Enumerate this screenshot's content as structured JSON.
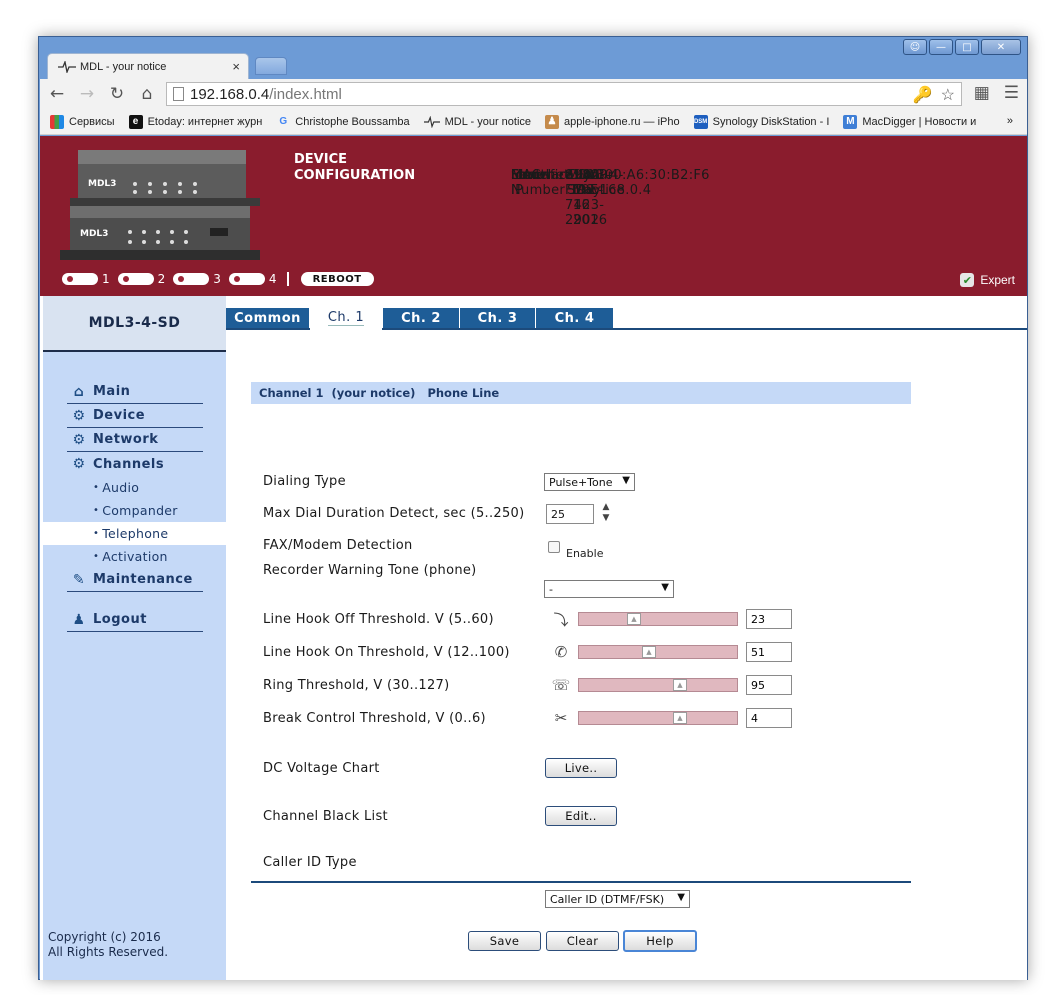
{
  "browser": {
    "tab_title": "MDL - your notice",
    "tab_close": "×",
    "url_host": "192.168.0.4",
    "url_path": "/index.html",
    "bookmarks": [
      {
        "icon": "apps-icon",
        "label": "Сервисы"
      },
      {
        "icon": "e-icon",
        "label": "Etoday: интернет журн"
      },
      {
        "icon": "google-icon",
        "label": "Christophe Boussamba"
      },
      {
        "icon": "pulse-icon",
        "label": "MDL - your notice"
      },
      {
        "icon": "person-icon",
        "label": "apple-iphone.ru — iPho"
      },
      {
        "icon": "dsm-icon",
        "label": "Synology DiskStation - I"
      },
      {
        "icon": "m-icon",
        "label": "MacDigger | Новости и"
      }
    ],
    "bookmarks_more": "»"
  },
  "header": {
    "title_line1": "DEVICE",
    "title_line2": "CONFIGURATION",
    "info": [
      {
        "key": "Model",
        "value": "MDL3-4-SD"
      },
      {
        "key": "Serial Number",
        "value": "898A-F59E-7423-2902"
      },
      {
        "key": "Firmware",
        "value": "1.00 - May 16 2016"
      },
      {
        "key": "MAC",
        "value": "02:00:A6:30:B2:F6"
      },
      {
        "key": "Ethernet IP",
        "value": "DHCP: 192.168.0.4"
      },
      {
        "key": "Identification",
        "value": "your notice"
      }
    ],
    "leds": [
      "1",
      "2",
      "3",
      "4"
    ],
    "reboot": "REBOOT",
    "expert": "Expert",
    "device_label_top": "MDL3",
    "device_label_bottom": "MDL3"
  },
  "sidebar": {
    "title": "MDL3-4-SD",
    "main": "Main",
    "device": "Device",
    "network": "Network",
    "channels": "Channels",
    "sub": [
      "Audio",
      "Compander",
      "Telephone",
      "Activation"
    ],
    "maintenance": "Maintenance",
    "logout": "Logout",
    "copyright1": "Copyright (c) 2016",
    "copyright2": "All Rights Reserved."
  },
  "tabs": [
    "Common",
    "Ch. 1",
    "Ch. 2",
    "Ch. 3",
    "Ch. 4"
  ],
  "channel": {
    "header_ch": "Channel 1",
    "header_name": "(your notice)",
    "header_type": "Phone Line"
  },
  "form": {
    "dialing_type_label": "Dialing Type",
    "dialing_type_value": "Pulse+Tone",
    "max_dial_label": "Max Dial Duration Detect, sec (5..250)",
    "max_dial_value": "25",
    "fax_label": "FAX/Modem Detection",
    "fax_enable": "Enable",
    "fax_checked": false,
    "recorder_label": "Recorder Warning Tone (phone)",
    "recorder_value": "-",
    "sliders": [
      {
        "label": "Line Hook Off Threshold. V (5..60)",
        "icon": "hook-off-icon",
        "value": "23",
        "fraction": 0.33
      },
      {
        "label": "Line Hook On Threshold, V (12..100)",
        "icon": "phone-icon",
        "value": "51",
        "fraction": 0.44
      },
      {
        "label": "Ring Threshold, V (30..127)",
        "icon": "ring-icon",
        "value": "95",
        "fraction": 0.65
      },
      {
        "label": "Break Control Threshold, V (0..6)",
        "icon": "break-icon",
        "value": "4",
        "fraction": 0.65
      }
    ],
    "dc_label": "DC Voltage Chart",
    "dc_button": "Live..",
    "blacklist_label": "Channel Black List",
    "blacklist_button": "Edit..",
    "callerid_label": "Caller ID Type",
    "callerid_value": "Caller ID (DTMF/FSK)"
  },
  "actions": {
    "save": "Save",
    "clear": "Clear",
    "help": "Help"
  }
}
